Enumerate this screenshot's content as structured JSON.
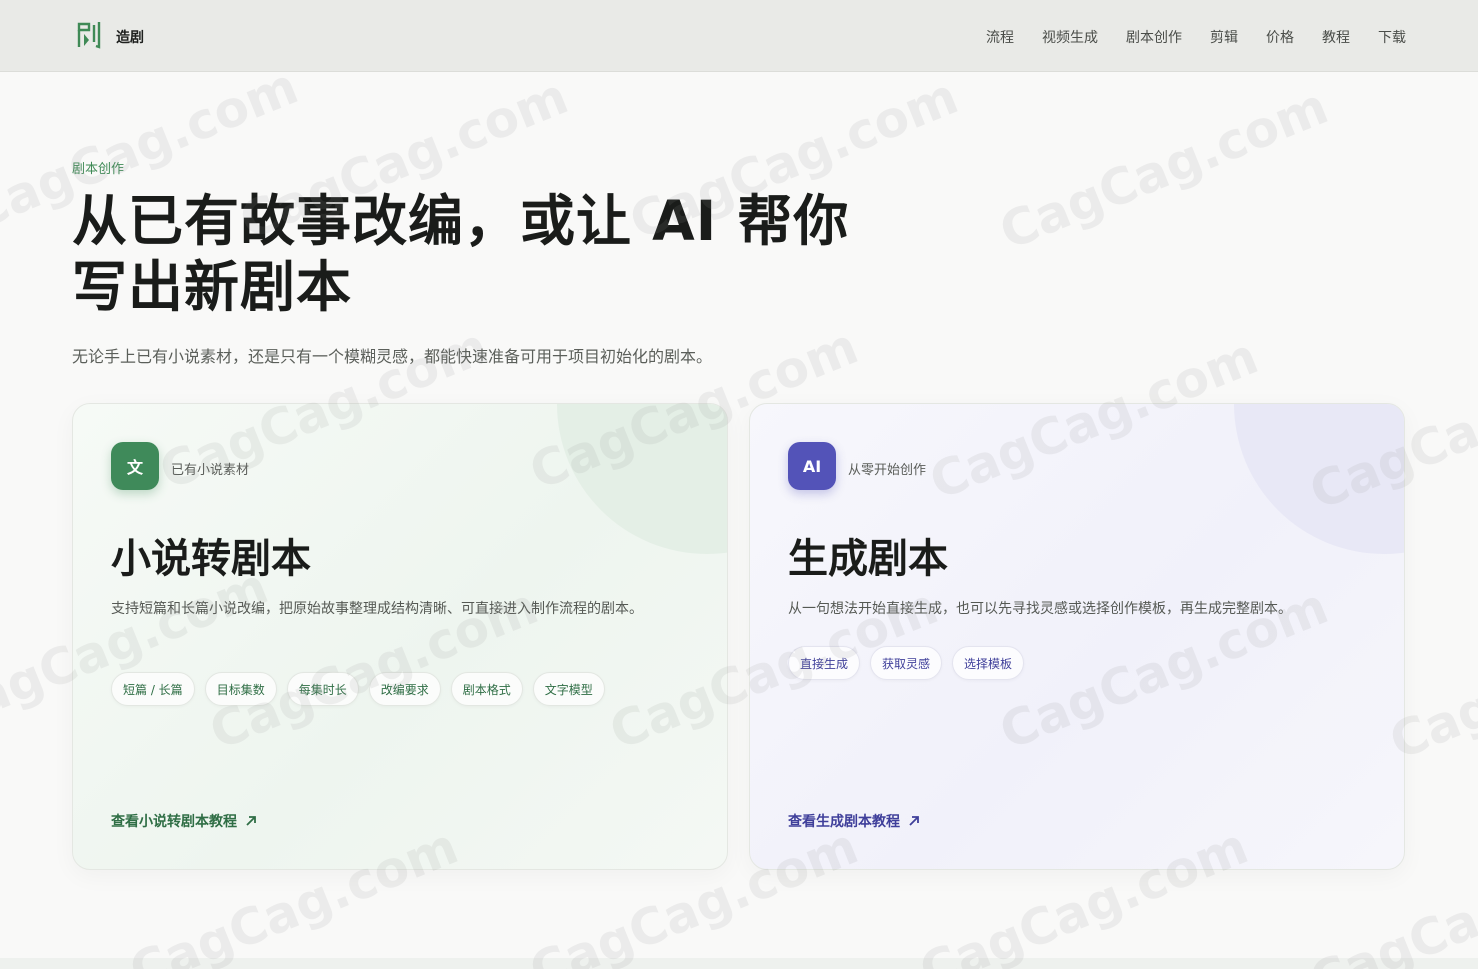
{
  "header": {
    "logo_text": "造剧",
    "nav": [
      "流程",
      "视频生成",
      "剧本创作",
      "剪辑",
      "价格",
      "教程",
      "下载"
    ]
  },
  "hero": {
    "eyebrow": "剧本创作",
    "title": "从已有故事改编，或让 AI 帮你写出新剧本",
    "subtitle": "无论手上已有小说素材，还是只有一个模糊灵感，都能快速准备可用于项目初始化的剧本。"
  },
  "cards": [
    {
      "badge": "文",
      "badge_label": "已有小说素材",
      "title": "小说转剧本",
      "description": "支持短篇和长篇小说改编，把原始故事整理成结构清晰、可直接进入制作流程的剧本。",
      "chips": [
        "短篇 / 长篇",
        "目标集数",
        "每集时长",
        "改编要求",
        "剧本格式",
        "文字模型"
      ],
      "link": "查看小说转剧本教程"
    },
    {
      "badge": "AI",
      "badge_label": "从零开始创作",
      "title": "生成剧本",
      "description": "从一句想法开始直接生成，也可以先寻找灵感或选择创作模板，再生成完整剧本。",
      "chips": [
        "直接生成",
        "获取灵感",
        "选择模板"
      ],
      "link": "查看生成剧本教程"
    }
  ],
  "watermark": "CagCag.com",
  "colors": {
    "accent_green": "#3f8a5a",
    "accent_purple": "#5353b8"
  }
}
